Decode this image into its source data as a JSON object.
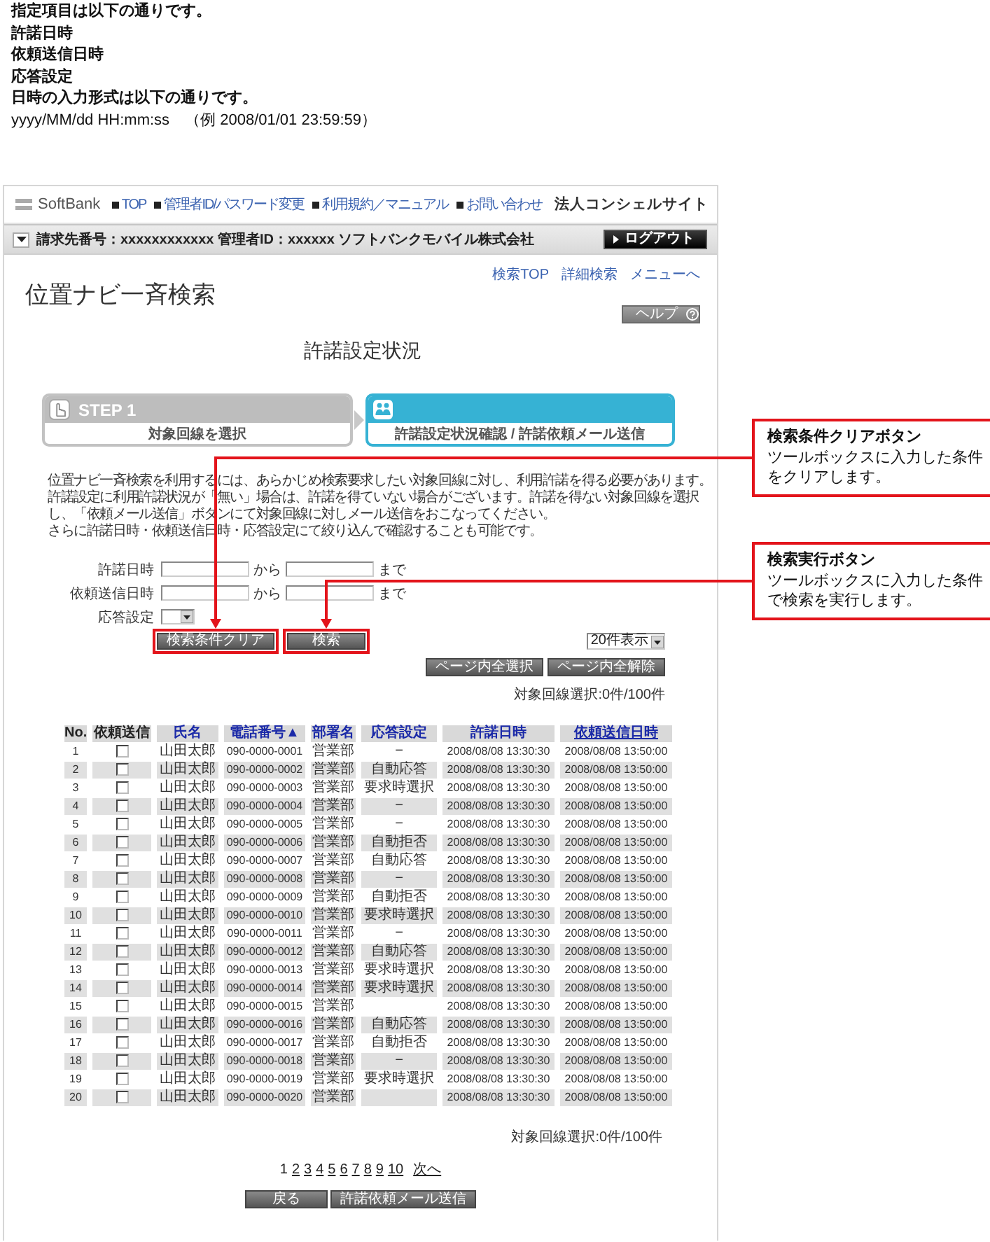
{
  "intro": {
    "heading": "指定項目は以下の通りです。",
    "items": [
      "許諾日時",
      "依頼送信日時",
      "応答設定"
    ],
    "format_note": "日時の入力形式は以下の通りです。",
    "format": "yyyy/MM/dd HH:mm:ss　（例 2008/01/01 23:59:59）"
  },
  "header": {
    "logo": "SoftBank",
    "nav": [
      "TOP",
      "管理者ID/パスワード変更",
      "利用規約／マニュアル",
      "お問い合わせ"
    ],
    "site_title": "法人コンシェルサイト"
  },
  "account_bar": {
    "info": "請求先番号：xxxxxxxxxxxx 管理者ID：xxxxxx ソフトバンクモバイル株式会社",
    "logout": "ログアウト"
  },
  "page": {
    "title": "位置ナビ一斉検索",
    "links": [
      "検索TOP",
      "詳細検索",
      "メニューへ"
    ],
    "help": "ヘルプ",
    "heading": "許諾設定状況"
  },
  "steps": [
    {
      "label": "STEP 1",
      "caption": "対象回線を選択",
      "selected": false
    },
    {
      "caption": "許諾設定状況確認 / 許諾依頼メール送信",
      "selected": true
    }
  ],
  "guide": [
    "位置ナビ一斉検索を利用するには、あらかじめ検索要求したい対象回線に対し、利用許諾を得る必要があります。",
    "許諾設定に利用許諾状況が「無い」場合は、許諾を得ていない場合がございます。許諾を得ない対象回線を選択し、「依頼メール送信」ボタンにて対象回線に対しメール送信をおこなってください。",
    "さらに許諾日時・依頼送信日時・応答設定にて絞り込んで確認することも可能です。"
  ],
  "search_form": {
    "fields": [
      {
        "kind": "range",
        "label": "許諾日時",
        "from": "から",
        "to": "まで"
      },
      {
        "kind": "range",
        "label": "依頼送信日時",
        "from": "から",
        "to": "まで"
      },
      {
        "kind": "select",
        "label": "応答設定"
      }
    ],
    "buttons": [
      {
        "label": "検索条件クリア",
        "highlighted": true
      },
      {
        "label": "検索",
        "highlighted": true
      }
    ]
  },
  "results": {
    "page_size": "20件表示",
    "page_buttons": [
      "ページ内全選択",
      "ページ内全解除"
    ],
    "count": "対象回線選択:0件/100件"
  },
  "table": {
    "columns": [
      {
        "label": "No.",
        "link": false,
        "underlined": false
      },
      {
        "label": "依頼送信",
        "link": false,
        "underlined": false
      },
      {
        "label": "氏名",
        "link": true,
        "underlined": false
      },
      {
        "label": "電話番号▲",
        "link": true,
        "underlined": false
      },
      {
        "label": "部署名",
        "link": true,
        "underlined": false
      },
      {
        "label": "応答設定",
        "link": true,
        "underlined": false
      },
      {
        "label": "許諾日時",
        "link": true,
        "underlined": false
      },
      {
        "label": "依頼送信日時",
        "link": true,
        "underlined": true
      }
    ],
    "rows": [
      {
        "no": "1",
        "checked": false,
        "name": "山田太郎",
        "phone": "090-0000-0001",
        "department": "営業部",
        "response": "−",
        "granted_at": "2008/08/08 13:30:30",
        "requested_at": "2008/08/08 13:50:00"
      },
      {
        "no": "2",
        "checked": false,
        "name": "山田太郎",
        "phone": "090-0000-0002",
        "department": "営業部",
        "response": "自動応答",
        "granted_at": "2008/08/08 13:30:30",
        "requested_at": "2008/08/08 13:50:00"
      },
      {
        "no": "3",
        "checked": false,
        "name": "山田太郎",
        "phone": "090-0000-0003",
        "department": "営業部",
        "response": "要求時選択",
        "granted_at": "2008/08/08 13:30:30",
        "requested_at": "2008/08/08 13:50:00"
      },
      {
        "no": "4",
        "checked": false,
        "name": "山田太郎",
        "phone": "090-0000-0004",
        "department": "営業部",
        "response": "−",
        "granted_at": "2008/08/08 13:30:30",
        "requested_at": "2008/08/08 13:50:00"
      },
      {
        "no": "5",
        "checked": false,
        "name": "山田太郎",
        "phone": "090-0000-0005",
        "department": "営業部",
        "response": "−",
        "granted_at": "2008/08/08 13:30:30",
        "requested_at": "2008/08/08 13:50:00"
      },
      {
        "no": "6",
        "checked": false,
        "name": "山田太郎",
        "phone": "090-0000-0006",
        "department": "営業部",
        "response": "自動拒否",
        "granted_at": "2008/08/08 13:30:30",
        "requested_at": "2008/08/08 13:50:00"
      },
      {
        "no": "7",
        "checked": false,
        "name": "山田太郎",
        "phone": "090-0000-0007",
        "department": "営業部",
        "response": "自動応答",
        "granted_at": "2008/08/08 13:30:30",
        "requested_at": "2008/08/08 13:50:00"
      },
      {
        "no": "8",
        "checked": false,
        "name": "山田太郎",
        "phone": "090-0000-0008",
        "department": "営業部",
        "response": "−",
        "granted_at": "2008/08/08 13:30:30",
        "requested_at": "2008/08/08 13:50:00"
      },
      {
        "no": "9",
        "checked": false,
        "name": "山田太郎",
        "phone": "090-0000-0009",
        "department": "営業部",
        "response": "自動拒否",
        "granted_at": "2008/08/08 13:30:30",
        "requested_at": "2008/08/08 13:50:00"
      },
      {
        "no": "10",
        "checked": false,
        "name": "山田太郎",
        "phone": "090-0000-0010",
        "department": "営業部",
        "response": "要求時選択",
        "granted_at": "2008/08/08 13:30:30",
        "requested_at": "2008/08/08 13:50:00"
      },
      {
        "no": "11",
        "checked": false,
        "name": "山田太郎",
        "phone": "090-0000-0011",
        "department": "営業部",
        "response": "−",
        "granted_at": "2008/08/08 13:30:30",
        "requested_at": "2008/08/08 13:50:00"
      },
      {
        "no": "12",
        "checked": false,
        "name": "山田太郎",
        "phone": "090-0000-0012",
        "department": "営業部",
        "response": "自動応答",
        "granted_at": "2008/08/08 13:30:30",
        "requested_at": "2008/08/08 13:50:00"
      },
      {
        "no": "13",
        "checked": false,
        "name": "山田太郎",
        "phone": "090-0000-0013",
        "department": "営業部",
        "response": "要求時選択",
        "granted_at": "2008/08/08 13:30:30",
        "requested_at": "2008/08/08 13:50:00"
      },
      {
        "no": "14",
        "checked": false,
        "name": "山田太郎",
        "phone": "090-0000-0014",
        "department": "営業部",
        "response": "要求時選択",
        "granted_at": "2008/08/08 13:30:30",
        "requested_at": "2008/08/08 13:50:00"
      },
      {
        "no": "15",
        "checked": false,
        "name": "山田太郎",
        "phone": "090-0000-0015",
        "department": "営業部",
        "granted_at": "2008/08/08 13:30:30",
        "requested_at": "2008/08/08 13:50:00"
      },
      {
        "no": "16",
        "checked": false,
        "name": "山田太郎",
        "phone": "090-0000-0016",
        "department": "営業部",
        "response": "自動応答",
        "granted_at": "2008/08/08 13:30:30",
        "requested_at": "2008/08/08 13:50:00"
      },
      {
        "no": "17",
        "checked": false,
        "name": "山田太郎",
        "phone": "090-0000-0017",
        "department": "営業部",
        "response": "自動拒否",
        "granted_at": "2008/08/08 13:30:30",
        "requested_at": "2008/08/08 13:50:00"
      },
      {
        "no": "18",
        "checked": false,
        "name": "山田太郎",
        "phone": "090-0000-0018",
        "department": "営業部",
        "response": "−",
        "granted_at": "2008/08/08 13:30:30",
        "requested_at": "2008/08/08 13:50:00"
      },
      {
        "no": "19",
        "checked": false,
        "name": "山田太郎",
        "phone": "090-0000-0019",
        "department": "営業部",
        "response": "要求時選択",
        "granted_at": "2008/08/08 13:30:30",
        "requested_at": "2008/08/08 13:50:00"
      },
      {
        "no": "20",
        "checked": false,
        "name": "山田太郎",
        "phone": "090-0000-0020",
        "department": "営業部",
        "granted_at": "2008/08/08 13:30:30",
        "requested_at": "2008/08/08 13:50:00"
      }
    ]
  },
  "footer": {
    "count": "対象回線選択:0件/100件",
    "pages": [
      {
        "label": "1",
        "selected": true
      },
      {
        "label": "2",
        "selected": false
      },
      {
        "label": "3",
        "selected": false
      },
      {
        "label": "4",
        "selected": false
      },
      {
        "label": "5",
        "selected": false
      },
      {
        "label": "6",
        "selected": false
      },
      {
        "label": "7",
        "selected": false
      },
      {
        "label": "8",
        "selected": false
      },
      {
        "label": "9",
        "selected": false
      },
      {
        "label": "10",
        "selected": false
      }
    ],
    "next": "次へ",
    "buttons": [
      "戻る",
      "許諾依頼メール送信"
    ]
  },
  "callouts": [
    {
      "title": "検索条件クリアボタン",
      "text": "ツールボックスに入力した条件をクリアします。"
    },
    {
      "title": "検索実行ボタン",
      "text": "ツールボックスに入力した条件で検索を実行します。"
    }
  ]
}
